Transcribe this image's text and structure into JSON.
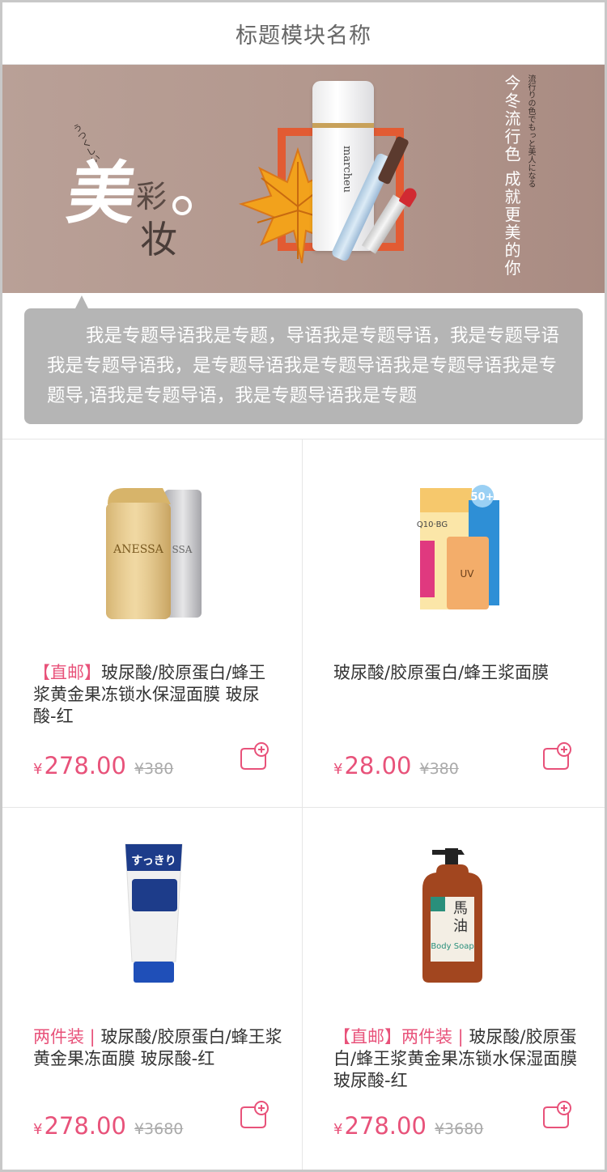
{
  "header": {
    "title": "标题模块名称"
  },
  "banner": {
    "kana": "うつくしい",
    "main_char": "美",
    "sub_char_1": "彩",
    "sub_char_2": "妆",
    "slogan": "今冬流行色 成就更美的你",
    "slogan_small": "流行りの色でもっと美人になる",
    "bottle_label": "marcheu"
  },
  "intro": {
    "text": "我是专题导语我是专题，导语我是专题导语，我是专题导语我是专题导语我，是专题导语我是专题导语我是专题导语我是专题导,语我是专题导语，我是专题导语我是专题"
  },
  "products": [
    {
      "tag": "【直邮】",
      "title": "玻尿酸/胶原蛋白/蜂王浆黄金果冻锁水保湿面膜 玻尿酸-红",
      "currency": "¥",
      "price": "278.00",
      "old_price": "¥380",
      "image": "sunscreen-bottles"
    },
    {
      "tag": "",
      "title": "玻尿酸/胶原蛋白/蜂王浆面膜",
      "currency": "¥",
      "price": "28.00",
      "old_price": "¥380",
      "image": "uv-essence-box"
    },
    {
      "tag": "两件装 | ",
      "title": "玻尿酸/胶原蛋白/蜂王浆黄金果冻面膜 玻尿酸-红",
      "currency": "¥",
      "price": "278.00",
      "old_price": "¥3680",
      "image": "face-gel-tube"
    },
    {
      "tag": "【直邮】两件装 | ",
      "title": "玻尿酸/胶原蛋白/蜂王浆黄金果冻锁水保湿面膜 玻尿酸-红",
      "currency": "¥",
      "price": "278.00",
      "old_price": "¥3680",
      "image": "horse-oil-body-soap"
    }
  ],
  "colors": {
    "accent": "#e8527a",
    "bubble": "#b5b5b5",
    "banner": "#b79a90"
  },
  "icons": {
    "cart": "add-to-basket-icon"
  }
}
